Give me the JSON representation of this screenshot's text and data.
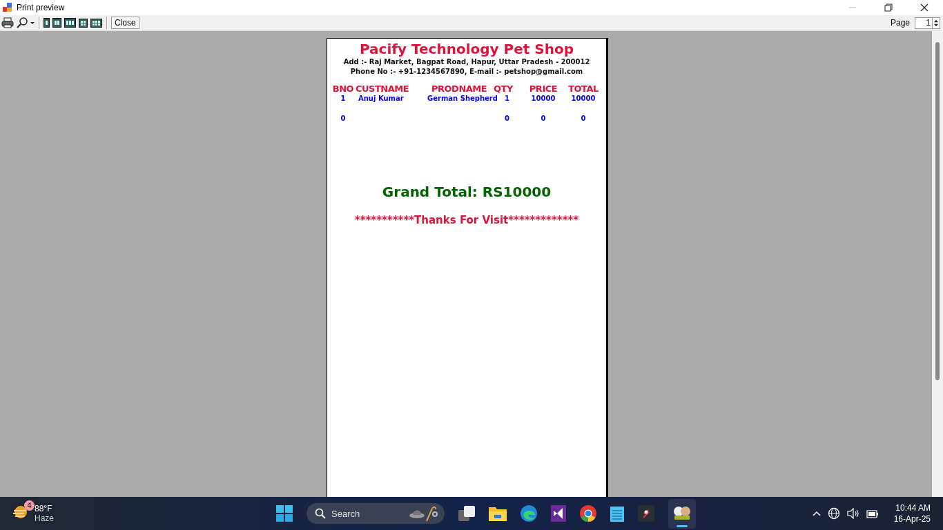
{
  "window": {
    "title": "Print preview"
  },
  "toolbar": {
    "close_label": "Close",
    "page_label": "Page",
    "page_value": "1"
  },
  "receipt": {
    "shop_name": "Pacify Technology Pet Shop",
    "address": "Add :- Raj Market, Bagpat Road, Hapur, Uttar Pradesh - 200012",
    "contact": "Phone No :- +91-1234567890, E-mail :- petshop@gmail.com",
    "columns": [
      "BNO",
      "CUSTNAME",
      "PRODNAME",
      "QTY",
      "PRICE",
      "TOTAL"
    ],
    "rows": [
      {
        "bno": "1",
        "custname": "Anuj Kumar",
        "prodname": "German Shepherd",
        "qty": "1",
        "price": "10000",
        "total": "10000"
      },
      {
        "bno": "0",
        "qty": "0",
        "price": "0",
        "total": "0"
      }
    ],
    "grand_total": "Grand Total: RS10000",
    "thanks": "***********Thanks For Visit*************"
  },
  "taskbar": {
    "weather": {
      "temp": "88°F",
      "condition": "Haze",
      "badge": "4"
    },
    "search_placeholder": "Search",
    "time": "10:44 AM",
    "date": "16-Apr-25"
  }
}
